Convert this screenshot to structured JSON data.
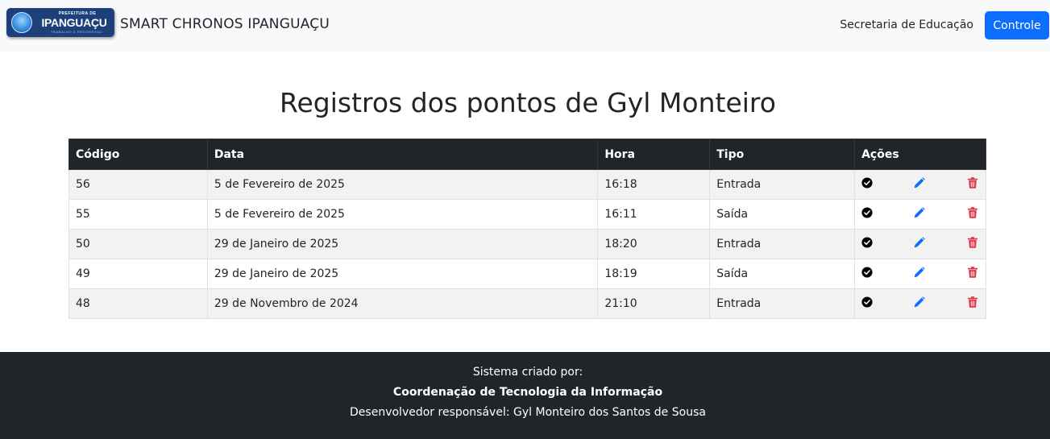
{
  "header": {
    "logo": {
      "top_text": "PREFEITURA DE",
      "main_text": "IPANGUAÇU",
      "sub_text": "TRABALHO E PROGRESSO"
    },
    "brand": "SMART CHRONOS IPANGUAÇU",
    "nav_link": "Secretaria de Educação",
    "controle_button": "Controle"
  },
  "main": {
    "title": "Registros dos pontos de Gyl Monteiro",
    "table": {
      "columns": [
        "Código",
        "Data",
        "Hora",
        "Tipo",
        "Ações"
      ],
      "rows": [
        {
          "codigo": "56",
          "data": "5 de Fevereiro de 2025",
          "hora": "16:18",
          "tipo": "Entrada"
        },
        {
          "codigo": "55",
          "data": "5 de Fevereiro de 2025",
          "hora": "16:11",
          "tipo": "Saída"
        },
        {
          "codigo": "50",
          "data": "29 de Janeiro de 2025",
          "hora": "18:20",
          "tipo": "Entrada"
        },
        {
          "codigo": "49",
          "data": "29 de Janeiro de 2025",
          "hora": "18:19",
          "tipo": "Saída"
        },
        {
          "codigo": "48",
          "data": "29 de Novembro de 2024",
          "hora": "21:10",
          "tipo": "Entrada"
        }
      ],
      "action_icons": [
        "check-circle-icon",
        "pencil-icon",
        "trash-icon"
      ]
    }
  },
  "footer": {
    "line1": "Sistema criado por:",
    "line2": "Coordenação de Tecnologia da Informação",
    "line3": "Desenvolvedor responsável: Gyl Monteiro dos Santos de Sousa"
  },
  "colors": {
    "primary": "#0d6efd",
    "dark": "#212529",
    "danger": "#dc3545",
    "navbar_bg": "#f8f9fa",
    "logo_bg": "#1d3f7a"
  }
}
